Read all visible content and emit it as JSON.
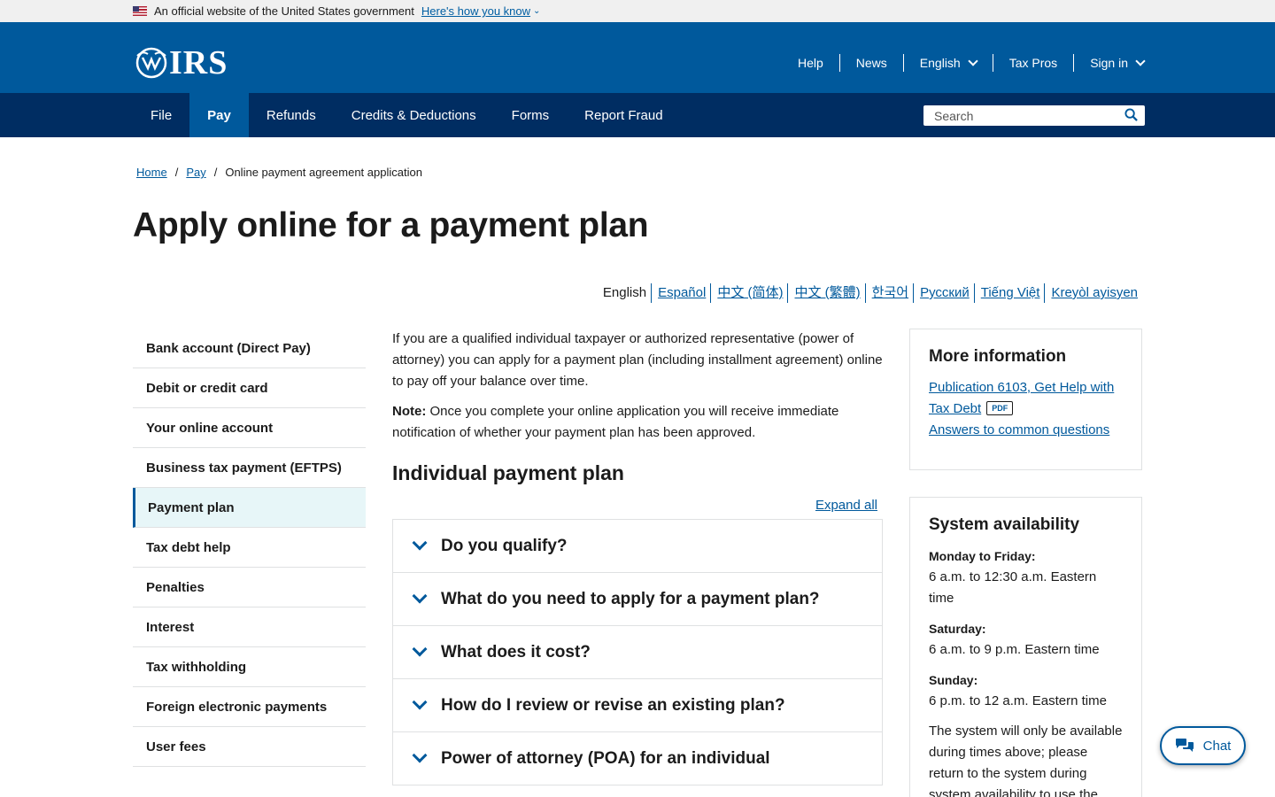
{
  "gov_banner": {
    "text": "An official website of the United States government",
    "link": "Here's how you know"
  },
  "header": {
    "logo_text": "IRS",
    "utility": [
      "Help",
      "News",
      "English",
      "Tax Pros",
      "Sign in"
    ]
  },
  "main_nav": {
    "items": [
      "File",
      "Pay",
      "Refunds",
      "Credits & Deductions",
      "Forms",
      "Report Fraud"
    ],
    "active": "Pay",
    "search_placeholder": "Search"
  },
  "breadcrumb": {
    "items": [
      "Home",
      "Pay"
    ],
    "current": "Online payment agreement application"
  },
  "page_title": "Apply online for a payment plan",
  "languages": [
    "English",
    "Español",
    "中文 (简体)",
    "中文 (繁體)",
    "한국어",
    "Русский",
    "Tiếng Việt",
    "Kreyòl ayisyen"
  ],
  "sidebar": {
    "items": [
      "Bank account (Direct Pay)",
      "Debit or credit card",
      "Your online account",
      "Business tax payment (EFTPS)",
      "Payment plan",
      "Tax debt help",
      "Penalties",
      "Interest",
      "Tax withholding",
      "Foreign electronic payments",
      "User fees"
    ],
    "active_index": 4
  },
  "content": {
    "intro": "If you are a qualified individual taxpayer or authorized representative (power of attorney) you can apply for a payment plan (including installment agreement) online to pay off your balance over time.",
    "note_label": "Note:",
    "note_text": " Once you complete your online application you will receive immediate notification of whether your payment plan has been approved.",
    "section_title": "Individual payment plan",
    "expand_all": "Expand all",
    "accordion": [
      "Do you qualify?",
      "What do you need to apply for a payment plan?",
      "What does it cost?",
      "How do I review or revise an existing plan?",
      "Power of attorney (POA) for an individual"
    ]
  },
  "more_info": {
    "title": "More information",
    "link1": "Publication 6103, Get Help with Tax Debt",
    "pdf": "PDF",
    "link2": "Answers to common questions"
  },
  "system_availability": {
    "title": "System availability",
    "rows": [
      {
        "label": "Monday to Friday:",
        "value": "6 a.m. to 12:30 a.m. Eastern time"
      },
      {
        "label": "Saturday:",
        "value": "6 a.m. to 9 p.m. Eastern time"
      },
      {
        "label": "Sunday:",
        "value": "6 p.m. to 12 a.m. Eastern time"
      }
    ],
    "note": "The system will only be available during times above; please return to the system during system availability to use the Online Payment Agreement"
  },
  "chat": {
    "label": "Chat"
  },
  "colors": {
    "primary": "#00599c",
    "nav_dark": "#002d62",
    "active_bg": "#e7f6f8"
  }
}
